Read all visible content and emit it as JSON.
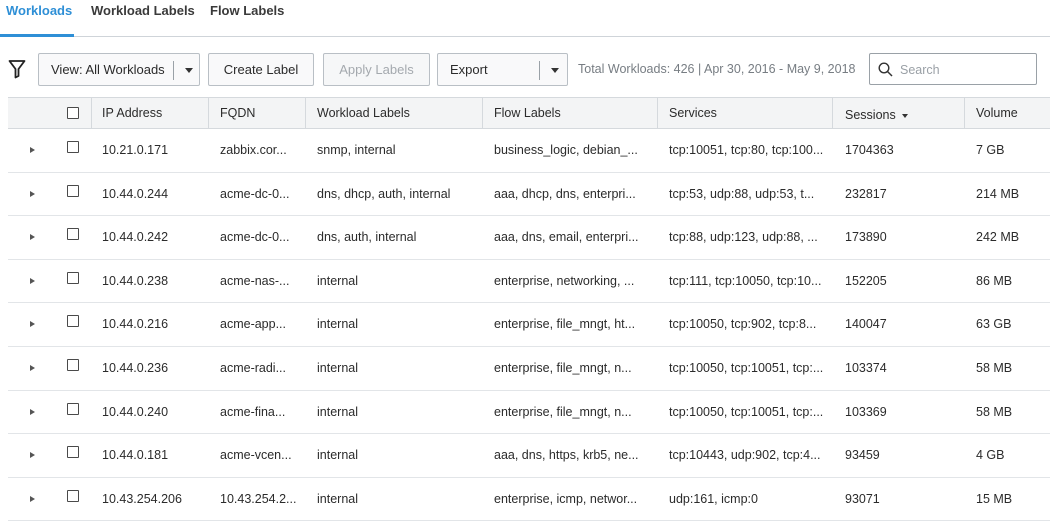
{
  "tabs": [
    {
      "label": "Workloads",
      "active": true
    },
    {
      "label": "Workload Labels",
      "active": false
    },
    {
      "label": "Flow Labels",
      "active": false
    }
  ],
  "toolbar": {
    "filter_icon": "filter-funnel-icon",
    "view_label": "View: All Workloads",
    "create_label": "Create Label",
    "apply_label": "Apply Labels",
    "export_label": "Export",
    "total_text": "Total Workloads: 426  | Apr 30, 2016 - May 9, 2018",
    "search_placeholder": "Search"
  },
  "table": {
    "columns": [
      "IP Address",
      "FQDN",
      "Workload Labels",
      "Flow Labels",
      "Services",
      "Sessions",
      "Volume"
    ],
    "sorted_column": "Sessions",
    "rows": [
      {
        "ip": "10.21.0.171",
        "fqdn": "zabbix.cor...",
        "workload_labels": "snmp, internal",
        "flow_labels": "business_logic, debian_...",
        "services": "tcp:10051, tcp:80, tcp:100...",
        "sessions": "1704363",
        "volume": "7 GB"
      },
      {
        "ip": "10.44.0.244",
        "fqdn": "acme-dc-0...",
        "workload_labels": "dns, dhcp, auth, internal",
        "flow_labels": "aaa, dhcp, dns, enterpri...",
        "services": "tcp:53, udp:88, udp:53, t...",
        "sessions": "232817",
        "volume": "214 MB"
      },
      {
        "ip": "10.44.0.242",
        "fqdn": "acme-dc-0...",
        "workload_labels": "dns, auth, internal",
        "flow_labels": "aaa, dns, email, enterpri...",
        "services": "tcp:88, udp:123, udp:88, ...",
        "sessions": "173890",
        "volume": "242 MB"
      },
      {
        "ip": "10.44.0.238",
        "fqdn": "acme-nas-...",
        "workload_labels": "internal",
        "flow_labels": "enterprise, networking, ...",
        "services": "tcp:111, tcp:10050, tcp:10...",
        "sessions": "152205",
        "volume": "86 MB"
      },
      {
        "ip": "10.44.0.216",
        "fqdn": "acme-app...",
        "workload_labels": "internal",
        "flow_labels": "enterprise, file_mngt, ht...",
        "services": "tcp:10050, tcp:902, tcp:8...",
        "sessions": "140047",
        "volume": "63 GB"
      },
      {
        "ip": "10.44.0.236",
        "fqdn": "acme-radi...",
        "workload_labels": "internal",
        "flow_labels": "enterprise, file_mngt, n...",
        "services": "tcp:10050, tcp:10051, tcp:...",
        "sessions": "103374",
        "volume": "58 MB"
      },
      {
        "ip": "10.44.0.240",
        "fqdn": "acme-fina...",
        "workload_labels": "internal",
        "flow_labels": "enterprise, file_mngt, n...",
        "services": "tcp:10050, tcp:10051, tcp:...",
        "sessions": "103369",
        "volume": "58 MB"
      },
      {
        "ip": "10.44.0.181",
        "fqdn": "acme-vcen...",
        "workload_labels": "internal",
        "flow_labels": "aaa, dns, https, krb5, ne...",
        "services": "tcp:10443, udp:902, tcp:4...",
        "sessions": "93459",
        "volume": "4 GB"
      },
      {
        "ip": "10.43.254.206",
        "fqdn": "10.43.254.2...",
        "workload_labels": "internal",
        "flow_labels": "enterprise, icmp, networ...",
        "services": "udp:161, icmp:0",
        "sessions": "93071",
        "volume": "15 MB"
      }
    ]
  },
  "colors": {
    "accent": "#2e8fd6",
    "header_bg": "#f3f4f5",
    "border": "#d5d9dd"
  }
}
